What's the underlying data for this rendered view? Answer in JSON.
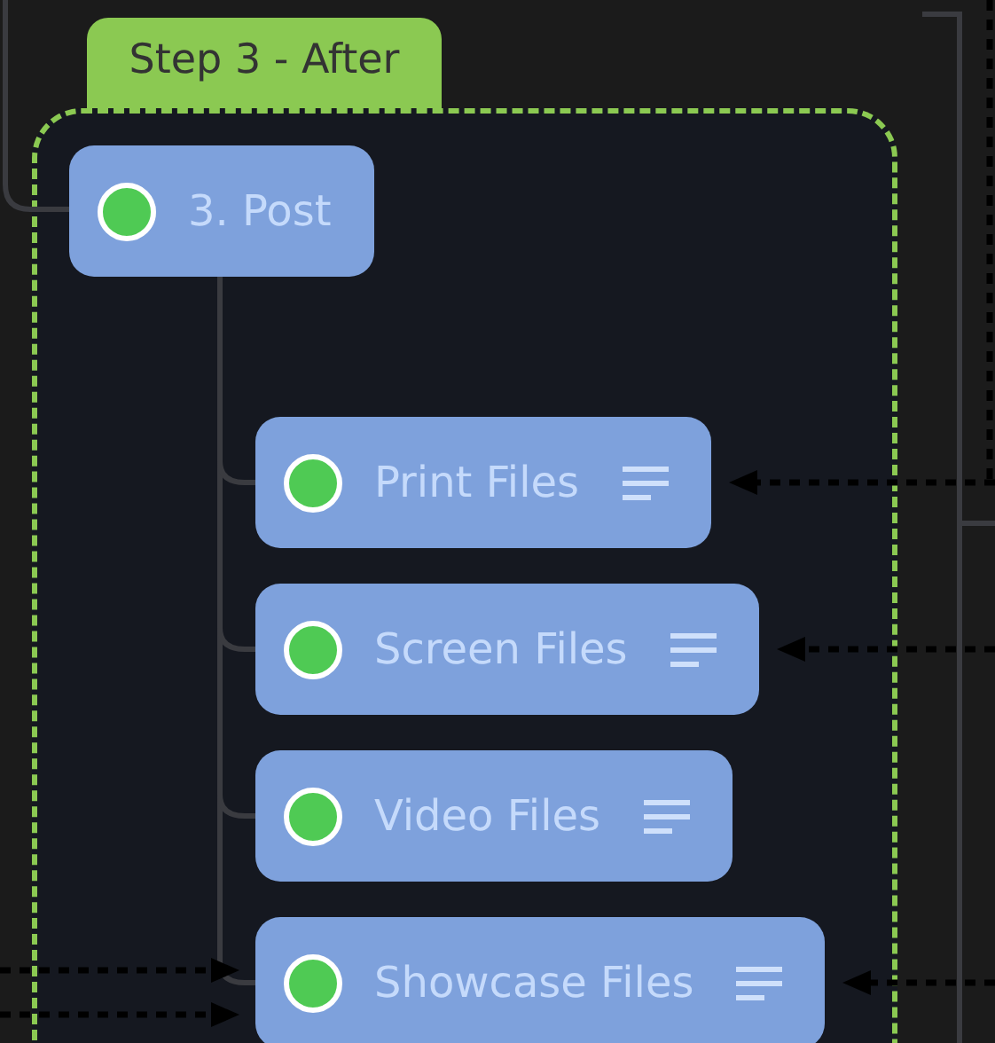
{
  "group": {
    "title": "Step 3 - After",
    "node": {
      "label": "3. Post",
      "children": [
        {
          "label": "Print Files"
        },
        {
          "label": "Screen Files"
        },
        {
          "label": "Video Files"
        },
        {
          "label": "Showcase Files"
        }
      ]
    }
  }
}
